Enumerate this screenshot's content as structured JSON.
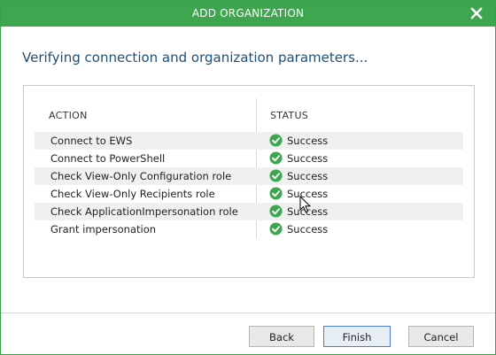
{
  "window": {
    "title": "ADD ORGANIZATION",
    "close_icon": "close-icon",
    "accent_color": "#3ea64e"
  },
  "heading": "Verifying connection and organization parameters...",
  "table": {
    "columns": [
      "ACTION",
      "STATUS"
    ],
    "rows": [
      {
        "action": "Connect to EWS",
        "status": "Success",
        "icon": "success-check-icon"
      },
      {
        "action": "Connect to PowerShell",
        "status": "Success",
        "icon": "success-check-icon"
      },
      {
        "action": "Check View-Only Configuration role",
        "status": "Success",
        "icon": "success-check-icon"
      },
      {
        "action": "Check View-Only Recipients role",
        "status": "Success",
        "icon": "success-check-icon"
      },
      {
        "action": "Check ApplicationImpersonation role",
        "status": "Success",
        "icon": "success-check-icon"
      },
      {
        "action": "Grant impersonation",
        "status": "Success",
        "icon": "success-check-icon"
      }
    ]
  },
  "buttons": {
    "back": "Back",
    "finish": "Finish",
    "cancel": "Cancel"
  }
}
